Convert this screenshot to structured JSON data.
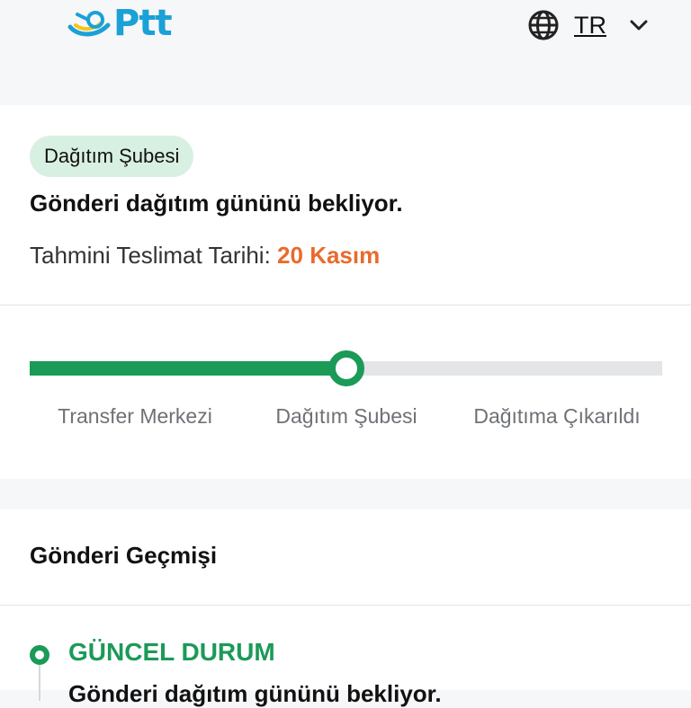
{
  "header": {
    "logo_text": "Ptt",
    "language": "TR",
    "icons": {
      "globe": "globe-icon",
      "chevron": "chevron-down-icon"
    }
  },
  "status": {
    "badge": "Dağıtım Şubesi",
    "title": "Gönderi dağıtım gününü bekliyor.",
    "eta_label": "Tahmini Teslimat Tarihi:",
    "eta_date": "20 Kasım"
  },
  "progress": {
    "steps": [
      "Transfer Merkezi",
      "Dağıtım Şubesi",
      "Dağıtıma Çıkarıldı"
    ],
    "current_step_index": 1,
    "completed_fraction": 0.5
  },
  "history": {
    "title": "Gönderi Geçmişi",
    "current_status_label": "GÜNCEL DURUM",
    "current_status_text": "Gönderi dağıtım gününü bekliyor."
  },
  "colors": {
    "accent_green": "#1b9a58",
    "badge_bg": "#d8f0e2",
    "eta_orange": "#ea6a2c",
    "logo_blue": "#1aa1d6",
    "logo_yellow": "#f5c518"
  }
}
